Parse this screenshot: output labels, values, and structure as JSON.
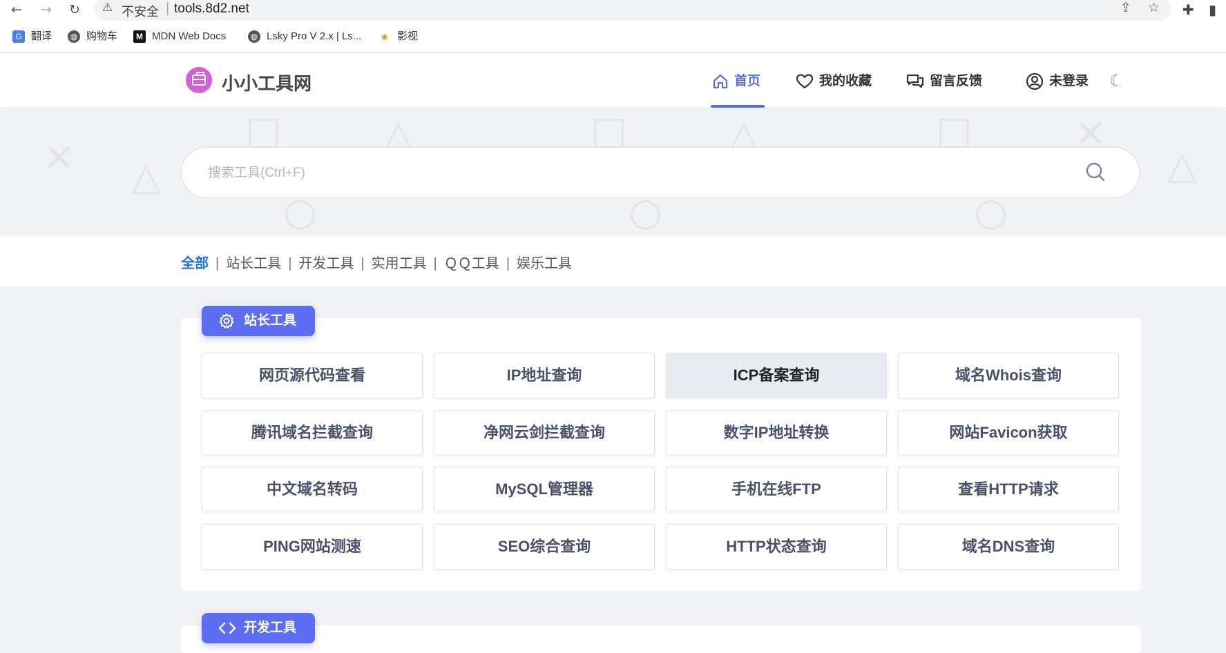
{
  "browser": {
    "security_label": "不安全",
    "url": "tools.8d2.net",
    "bookmarks": [
      "翻译",
      "购物车",
      "MDN Web Docs",
      "Lsky Pro V 2.x | Ls...",
      "影视"
    ]
  },
  "site": {
    "logo_text": "小小工具网",
    "nav": [
      {
        "label": "首页",
        "active": true,
        "icon": "home-icon"
      },
      {
        "label": "我的收藏",
        "active": false,
        "icon": "heart-icon"
      },
      {
        "label": "留言反馈",
        "active": false,
        "icon": "chat-icon"
      },
      {
        "label": "未登录",
        "active": false,
        "icon": "user-icon"
      }
    ],
    "theme_toggle_icon": "moon-icon",
    "accent_color": "#5d6df2"
  },
  "search": {
    "placeholder": "搜索工具(Ctrl+F)",
    "value": ""
  },
  "categories": {
    "items": [
      "全部",
      "站长工具",
      "开发工具",
      "实用工具",
      "ＱＱ工具",
      "娱乐工具"
    ],
    "active": "全部",
    "separator": "|"
  },
  "sections": [
    {
      "title": "站长工具",
      "icon": "gear-icon",
      "tools": [
        "网页源代码查看",
        "IP地址查询",
        "ICP备案查询",
        "域名Whois查询",
        "腾讯域名拦截查询",
        "净网云剑拦截查询",
        "数字IP地址转换",
        "网站Favicon获取",
        "中文域名转码",
        "MySQL管理器",
        "手机在线FTP",
        "查看HTTP请求",
        "PING网站测速",
        "SEO综合查询",
        "HTTP状态查询",
        "域名DNS查询"
      ],
      "highlighted_tool": "ICP备案查询"
    },
    {
      "title": "开发工具",
      "icon": "code-icon",
      "tools": []
    }
  ]
}
